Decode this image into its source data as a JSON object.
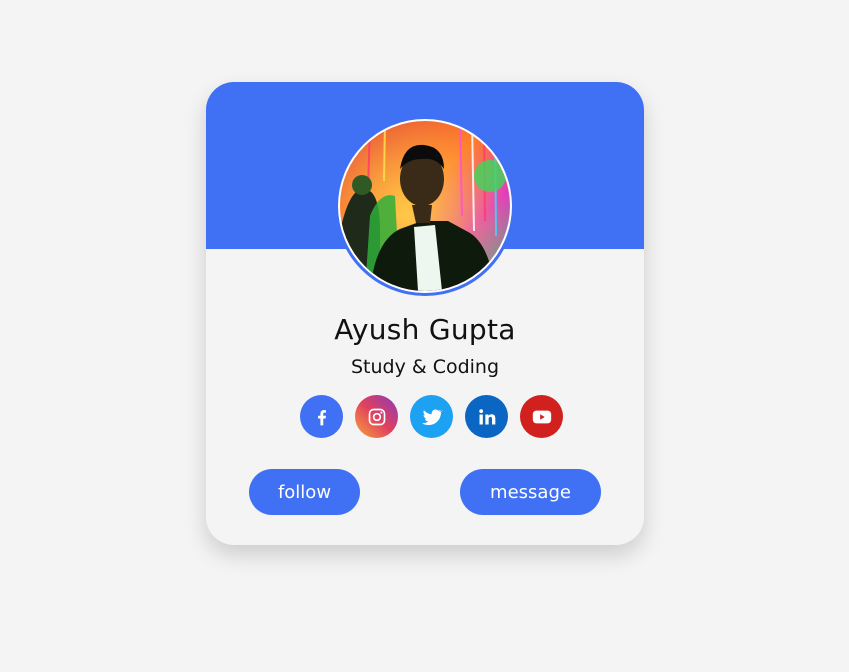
{
  "profile": {
    "name": "Ayush Gupta",
    "role": "Study & Coding"
  },
  "socials": [
    {
      "icon": "facebook-icon",
      "color": "#4070f4"
    },
    {
      "icon": "instagram-icon",
      "color": "gradient-purple-orange"
    },
    {
      "icon": "twitter-icon",
      "color": "#1da1f2"
    },
    {
      "icon": "linkedin-icon",
      "color": "#0a66c2"
    },
    {
      "icon": "youtube-icon",
      "color": "#d0211f"
    }
  ],
  "actions": {
    "follow_label": "follow",
    "message_label": "message"
  },
  "colors": {
    "accent": "#4070f4",
    "background": "#f4f4f4"
  }
}
